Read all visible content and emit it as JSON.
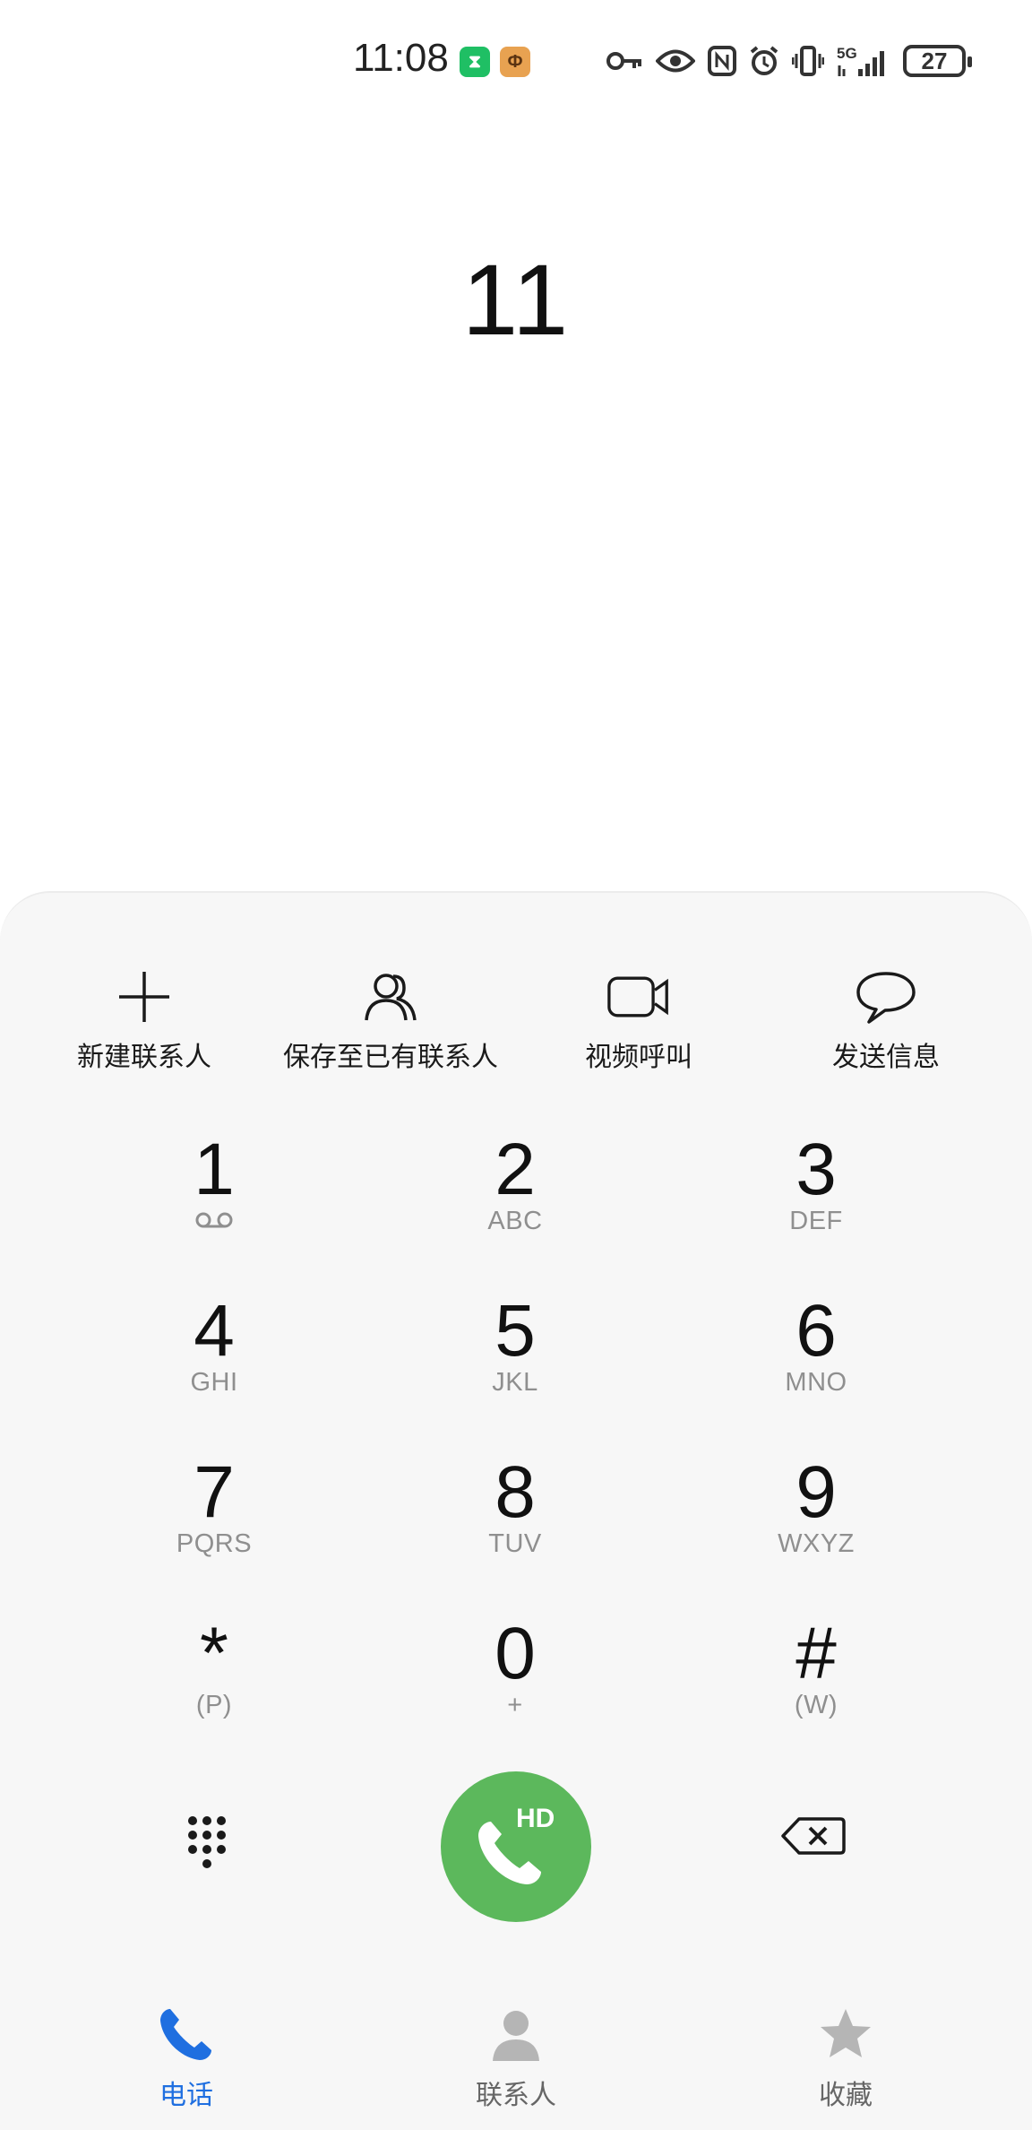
{
  "status_bar": {
    "time": "11:08",
    "battery": "27",
    "network": "5G",
    "icons": [
      "timer-app-icon",
      "app-icon",
      "key-icon",
      "eye-icon",
      "nfc-icon",
      "alarm-icon",
      "vibrate-icon",
      "signal-icon",
      "battery-icon"
    ]
  },
  "display": {
    "number": "11"
  },
  "actions": [
    {
      "label": "新建联系人",
      "icon": "plus-icon"
    },
    {
      "label": "保存至已有联系人",
      "icon": "contacts-icon"
    },
    {
      "label": "视频呼叫",
      "icon": "video-call-icon"
    },
    {
      "label": "发送信息",
      "icon": "message-icon"
    }
  ],
  "keypad": {
    "keys": [
      {
        "digit": "1",
        "sub": ""
      },
      {
        "digit": "2",
        "sub": "ABC"
      },
      {
        "digit": "3",
        "sub": "DEF"
      },
      {
        "digit": "4",
        "sub": "GHI"
      },
      {
        "digit": "5",
        "sub": "JKL"
      },
      {
        "digit": "6",
        "sub": "MNO"
      },
      {
        "digit": "7",
        "sub": "PQRS"
      },
      {
        "digit": "8",
        "sub": "TUV"
      },
      {
        "digit": "9",
        "sub": "WXYZ"
      },
      {
        "digit": "*",
        "sub": "(P)"
      },
      {
        "digit": "0",
        "sub": "+"
      },
      {
        "digit": "#",
        "sub": "(W)"
      }
    ],
    "call_label": "HD"
  },
  "nav": {
    "phone": "电话",
    "contacts": "联系人",
    "favorites": "收藏"
  },
  "colors": {
    "call_green": "#5cb85c",
    "active_blue": "#1f6fe0",
    "panel_bg": "#f7f7f7"
  }
}
